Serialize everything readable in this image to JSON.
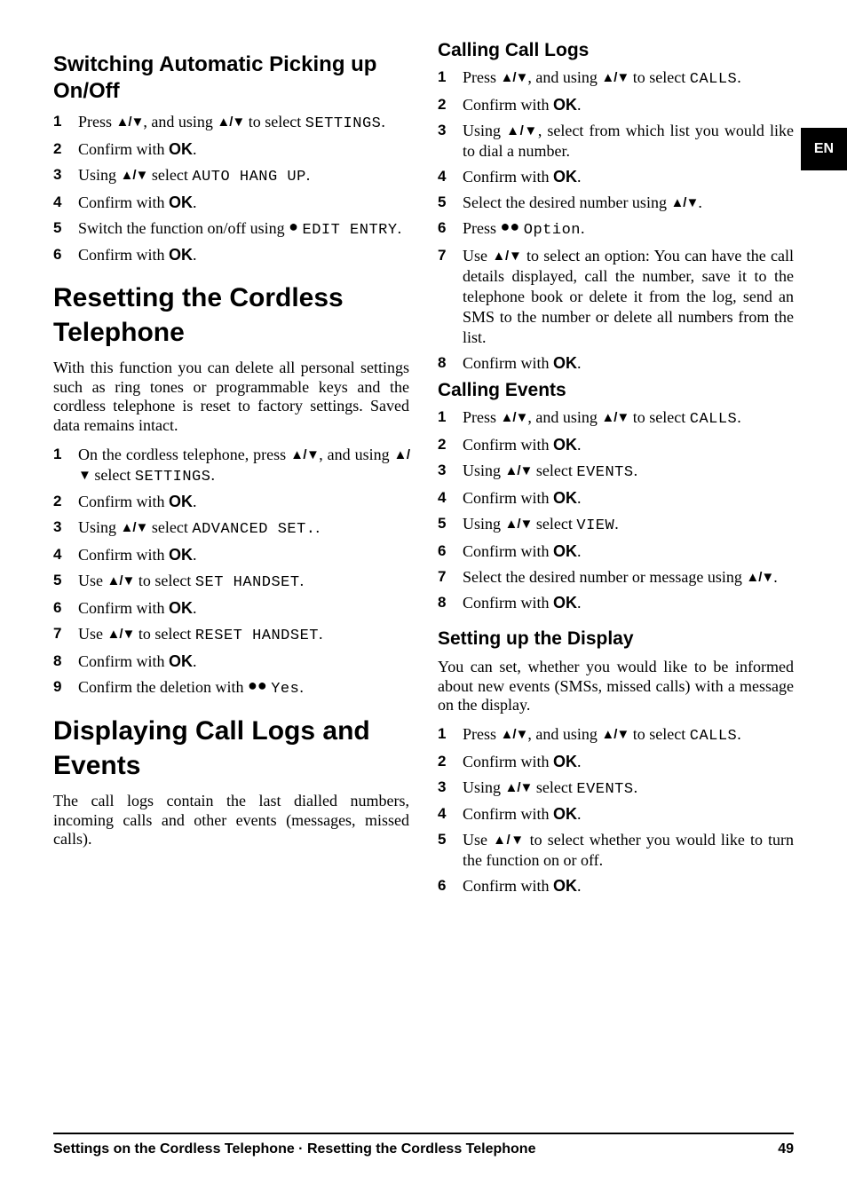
{
  "lang_tab": "EN",
  "nav_glyph": "▲/▼",
  "dot_glyph": "●",
  "dot2_glyph": "●●",
  "ok": "OK",
  "footer": {
    "left": "Settings on the Cordless Telephone  · Resetting the Cordless Telephone",
    "page": "49"
  },
  "s1": {
    "heading": "Switching Automatic Picking up On/Off",
    "steps": {
      "1a": "Press ",
      "1b": ", and using ",
      "1c": " to select ",
      "1d": "SETTINGS",
      "1e": ".",
      "2a": "Confirm with ",
      "2b": ".",
      "3a": "Using ",
      "3b": " select ",
      "3c": "AUTO HANG UP",
      "3d": ".",
      "4a": "Confirm with ",
      "4b": ".",
      "5a": "Switch the function on/off using ",
      "5b": " ",
      "5c": "EDIT ENTRY",
      "5d": ".",
      "6a": "Confirm with ",
      "6b": "."
    }
  },
  "s2": {
    "heading": "Resetting the Cordless Telephone",
    "intro": "With this function you can delete all personal settings such as ring tones or programmable keys and the cordless telephone is reset to factory settings. Saved data remains intact.",
    "steps": {
      "1a": "On the cordless telephone, press ",
      "1b": ", and using ",
      "1c": " select ",
      "1d": "SETTINGS",
      "1e": ".",
      "2a": "Confirm with ",
      "2b": ".",
      "3a": "Using ",
      "3b": " select ",
      "3c": "ADVANCED SET.",
      "3d": ".",
      "4a": "Confirm with ",
      "4b": ".",
      "5a": "Use ",
      "5b": " to select ",
      "5c": "SET HANDSET",
      "5d": ".",
      "6a": "Confirm with ",
      "6b": ".",
      "7a": "Use ",
      "7b": " to select ",
      "7c": "RESET HANDSET",
      "7d": ".",
      "8a": "Confirm with ",
      "8b": ".",
      "9a": "Confirm the deletion with ",
      "9b": " ",
      "9c": "Yes",
      "9d": "."
    }
  },
  "s3": {
    "heading": "Displaying Call Logs and Events",
    "intro": "The call logs contain the last dialled numbers, incoming calls and other events (messages, missed calls)."
  },
  "s4": {
    "heading": "Calling Call Logs",
    "steps": {
      "1a": "Press ",
      "1b": ", and using ",
      "1c": " to select ",
      "1d": "CALLS",
      "1e": ".",
      "2a": "Confirm with ",
      "2b": ".",
      "3a": "Using ",
      "3b": ", select from which list you would like to dial a number.",
      "4a": "Confirm with ",
      "4b": ".",
      "5a": "Select the desired number using ",
      "5b": ".",
      "6a": "Press ",
      "6b": " ",
      "6c": "Option",
      "6d": ".",
      "7a": "Use ",
      "7b": " to select an option: You can have the call details displayed, call the number, save it to the telephone book or delete it from the log, send an SMS to the number or delete all numbers from the list.",
      "8a": "Confirm with ",
      "8b": "."
    }
  },
  "s5": {
    "heading": "Calling Events",
    "steps": {
      "1a": "Press ",
      "1b": ", and using ",
      "1c": " to select ",
      "1d": "CALLS",
      "1e": ".",
      "2a": "Confirm with ",
      "2b": ".",
      "3a": "Using ",
      "3b": " select ",
      "3c": "EVENTS",
      "3d": ".",
      "4a": "Confirm with ",
      "4b": ".",
      "5a": "Using ",
      "5b": " select ",
      "5c": "VIEW",
      "5d": ".",
      "6a": "Confirm with ",
      "6b": ".",
      "7a": "Select the desired number or message using ",
      "7b": ".",
      "8a": "Confirm with ",
      "8b": "."
    }
  },
  "s6": {
    "heading": "Setting up the Display",
    "intro": "You can set, whether you would like to be informed about new events (SMSs, missed calls) with a message on the display.",
    "steps": {
      "1a": "Press ",
      "1b": ", and using ",
      "1c": " to select ",
      "1d": "CALLS",
      "1e": ".",
      "2a": "Confirm with ",
      "2b": ".",
      "3a": "Using ",
      "3b": " select ",
      "3c": "EVENTS",
      "3d": ".",
      "4a": "Confirm with ",
      "4b": ".",
      "5a": "Use ",
      "5b": " to select whether you would like to turn the function on or off.",
      "6a": "Confirm with ",
      "6b": "."
    }
  }
}
